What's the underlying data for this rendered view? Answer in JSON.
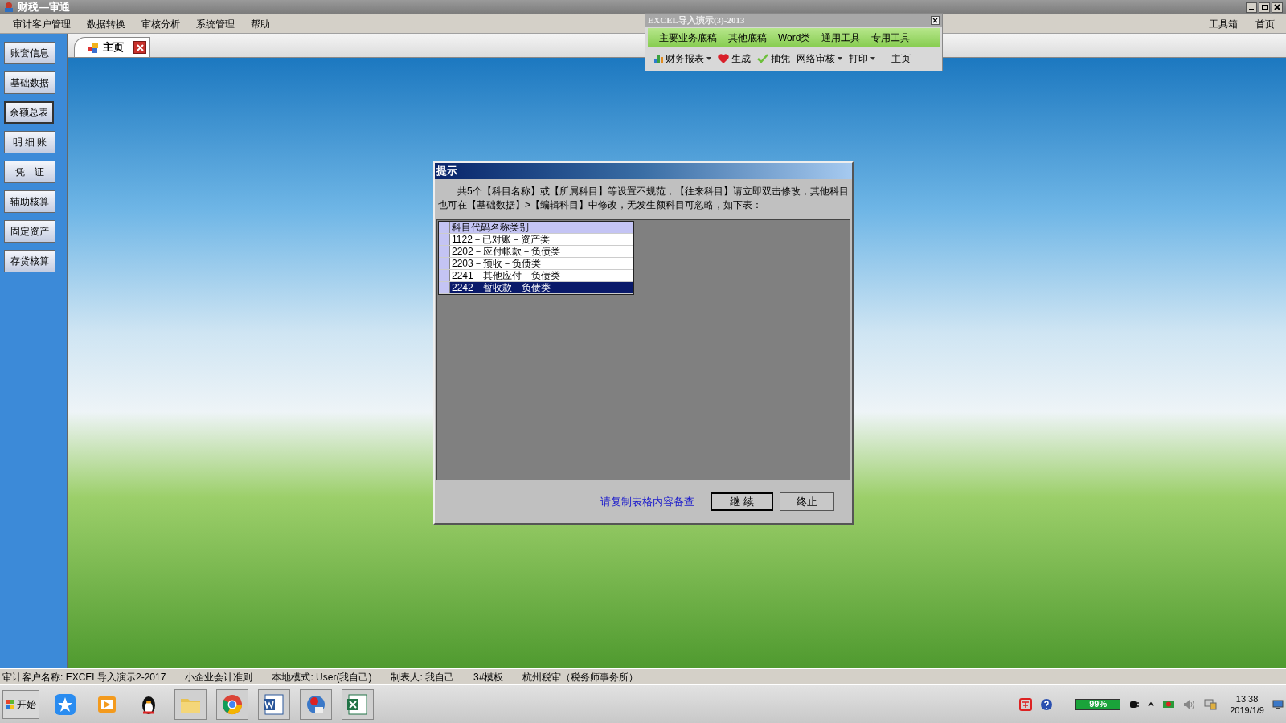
{
  "window": {
    "title": "财税—审通"
  },
  "menu": [
    "审计客户管理",
    "数据转换",
    "审核分析",
    "系统管理",
    "帮助"
  ],
  "sidebar": [
    {
      "label": "账套信息",
      "selected": false
    },
    {
      "label": "基础数据",
      "selected": false
    },
    {
      "label": "余额总表",
      "selected": true
    },
    {
      "label": "明 细 账",
      "selected": false
    },
    {
      "label": "凭　证",
      "selected": false
    },
    {
      "label": "辅助核算",
      "selected": false
    },
    {
      "label": "固定资产",
      "selected": false
    },
    {
      "label": "存货核算",
      "selected": false
    }
  ],
  "tabs": [
    {
      "label": "主页",
      "selected": true
    }
  ],
  "right_toolbar": [
    "工具箱",
    "首页"
  ],
  "floating_toolbar": {
    "title": "EXCEL导入演示(3)-2013",
    "groups": [
      "主要业务底稿",
      "其他底稿",
      "Word类",
      "通用工具",
      "专用工具"
    ],
    "tools": [
      {
        "label": "财务报表",
        "dropdown": true
      },
      {
        "label": "生成",
        "dropdown": false
      },
      {
        "label": "抽凭",
        "dropdown": false
      },
      {
        "label": "网络审核",
        "dropdown": true
      },
      {
        "label": "打印",
        "dropdown": true
      },
      {
        "label": "主页",
        "dropdown": false
      }
    ]
  },
  "dialog": {
    "title": "提示",
    "message": "共5个【科目名称】或【所属科目】等设置不规范，【往来科目】请立即双击修改，其他科目也可在【基础数据】>【编辑科目】中修改，无发生额科目可忽略，如下表：",
    "table": {
      "header": "科目代码名称类别",
      "rows": [
        {
          "text": "1122－已对账－资产类",
          "selected": false
        },
        {
          "text": "2202－应付帐款－负债类",
          "selected": false
        },
        {
          "text": "2203－预收－负债类",
          "selected": false
        },
        {
          "text": "2241－其他应付－负债类",
          "selected": false
        },
        {
          "text": "2242－暂收款－负债类",
          "selected": true
        }
      ]
    },
    "note": "请复制表格内容备查",
    "buttons": [
      {
        "label": "继 续",
        "default": true
      },
      {
        "label": "终止",
        "default": false
      }
    ]
  },
  "status_bar": [
    "审计客户名称: EXCEL导入演示2-2017",
    "小企业会计准则",
    "本地模式: User(我自己)",
    "制表人: 我自己",
    "3#模板",
    "杭州税审（税务师事务所）"
  ],
  "taskbar": {
    "start": "开始",
    "battery": "99%",
    "time": "13:38",
    "date": "2019/1/9"
  }
}
